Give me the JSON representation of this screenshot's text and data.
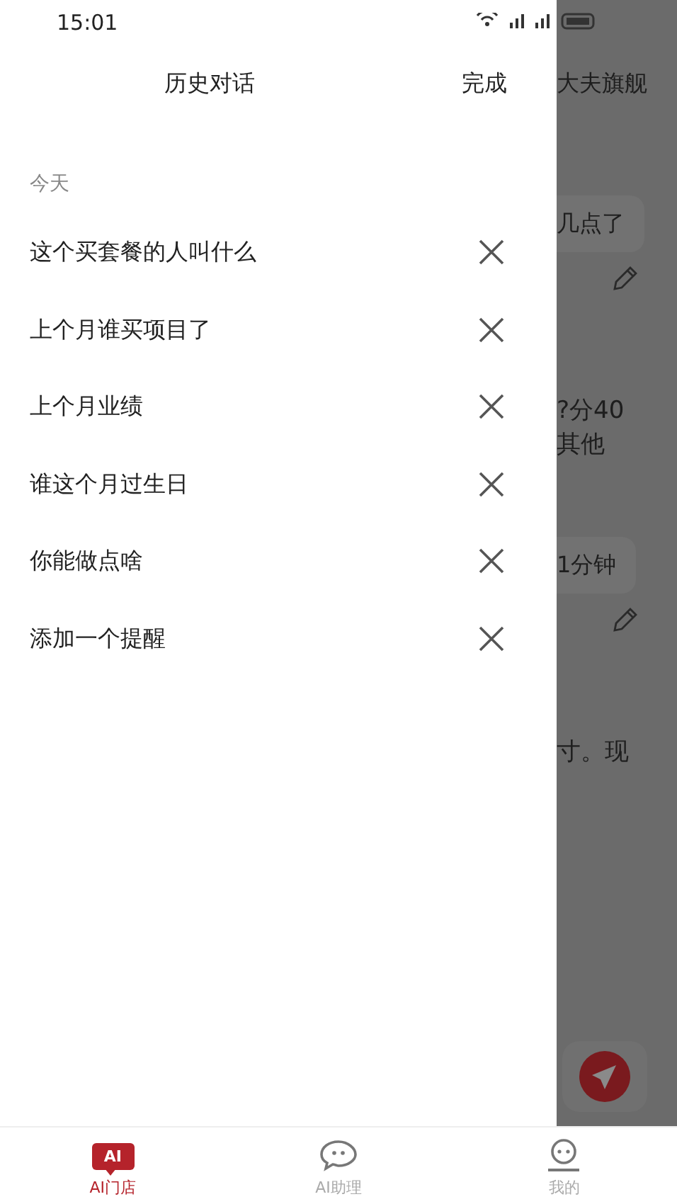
{
  "status_bar": {
    "time": "15:01"
  },
  "drawer": {
    "title": "历史对话",
    "done": "完成",
    "section": "今天",
    "items": [
      {
        "text": "这个买套餐的人叫什么"
      },
      {
        "text": "上个月谁买项目了"
      },
      {
        "text": "上个月业绩"
      },
      {
        "text": "谁这个月过生日"
      },
      {
        "text": "你能做点啥"
      },
      {
        "text": "添加一个提醒"
      }
    ]
  },
  "background": {
    "title": "大夫旗舰",
    "messages": [
      {
        "kind": "bubble",
        "text": "几点了"
      },
      {
        "kind": "edit"
      },
      {
        "kind": "text",
        "lines": [
          "?分40",
          "其他"
        ]
      },
      {
        "kind": "bubble",
        "text": "1分钟"
      },
      {
        "kind": "edit"
      },
      {
        "kind": "text",
        "lines": [
          "寸。现"
        ]
      }
    ]
  },
  "tabs": [
    {
      "label": "AI门店",
      "kind": "badge",
      "badge_text": "AI",
      "selected": true
    },
    {
      "label": "AI助理",
      "kind": "chat",
      "selected": false
    },
    {
      "label": "我的",
      "kind": "face",
      "selected": false
    }
  ]
}
